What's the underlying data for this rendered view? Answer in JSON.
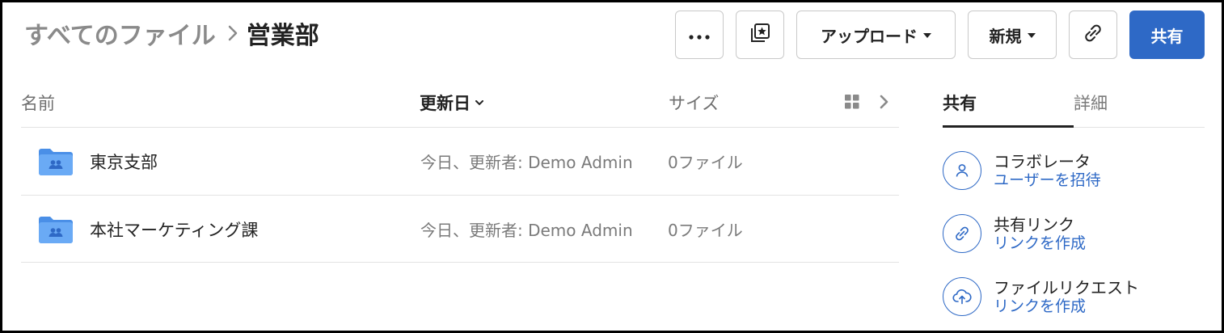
{
  "breadcrumb": {
    "root": "すべてのファイル",
    "current": "営業部"
  },
  "toolbar": {
    "more_icon": "more-horizontal-icon",
    "collections_icon": "collections-star-icon",
    "upload_label": "アップロード",
    "new_label": "新規",
    "link_icon": "link-icon",
    "share_label": "共有"
  },
  "list": {
    "columns": {
      "name": "名前",
      "updated": "更新日",
      "size": "サイズ"
    },
    "rows": [
      {
        "name": "東京支部",
        "updated": "今日、更新者: Demo Admin",
        "size": "0ファイル",
        "icon": "shared-folder-icon"
      },
      {
        "name": "本社マーケティング課",
        "updated": "今日、更新者: Demo Admin",
        "size": "0ファイル",
        "icon": "shared-folder-icon"
      }
    ]
  },
  "sidebar": {
    "tabs": [
      {
        "label": "共有",
        "active": true
      },
      {
        "label": "詳細",
        "active": false
      }
    ],
    "items": [
      {
        "title": "コラボレータ",
        "link": "ユーザーを招待",
        "icon": "user-icon"
      },
      {
        "title": "共有リンク",
        "link": "リンクを作成",
        "icon": "link-icon"
      },
      {
        "title": "ファイルリクエスト",
        "link": "リンクを作成",
        "icon": "upload-cloud-icon"
      }
    ]
  },
  "colors": {
    "accent": "#2e69c6",
    "folder": "#5b9ef0",
    "muted_text": "#7a7a7a"
  }
}
